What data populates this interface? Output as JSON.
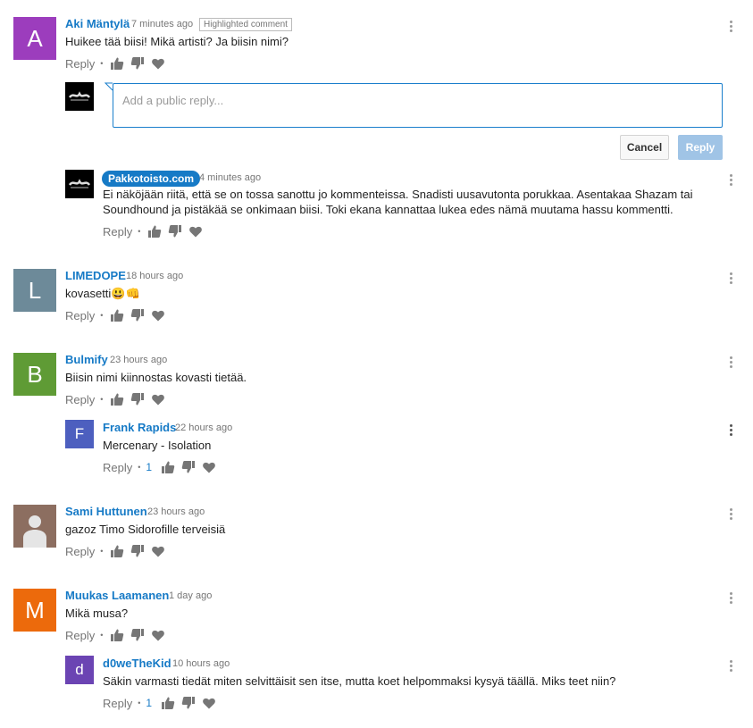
{
  "labels": {
    "reply": "Reply",
    "bullet": "•"
  },
  "reply_form": {
    "placeholder": "Add a public reply...",
    "cancel": "Cancel",
    "submit": "Reply"
  },
  "comments": [
    {
      "author": "Aki Mäntylä",
      "time": "7 minutes ago",
      "badge": "Highlighted comment",
      "text": "Huikee tää biisi! Mikä artisti? Ja biisin nimi?",
      "avatar_letter": "A",
      "avatar_color": "#9c3dbd"
    },
    {
      "author": "Pakkotoisto.com",
      "time": "4 minutes ago",
      "is_channel_owner": true,
      "text": "Ei näköjään riitä, että se on tossa sanottu jo kommenteissa. Snadisti uusavutonta porukkaa. Asentakaa Shazam tai Soundhound ja pistäkää se onkimaan biisi. Toki ekana kannattaa lukea edes nämä muutama hassu kommentti."
    },
    {
      "author": "LIMEDOPE",
      "time": "18 hours ago",
      "text": "kovasetti",
      "emoji": [
        "😃",
        "👊"
      ],
      "avatar_letter": "L",
      "avatar_color": "#6d8a99"
    },
    {
      "author": "Bulmify",
      "time": "23 hours ago",
      "text": "Biisin nimi kiinnostas kovasti tietää.",
      "avatar_letter": "B",
      "avatar_color": "#5f9b35"
    },
    {
      "author": "Frank Rapids",
      "time": "22 hours ago",
      "text": "Mercenary - Isolation",
      "likes": "1",
      "avatar_letter": "F",
      "avatar_color": "#4d5fbf"
    },
    {
      "author": "Sami Huttunen",
      "time": "23 hours ago",
      "text": "gazoz Timo Sidorofille terveisiä",
      "avatar_color": "#8c6e60"
    },
    {
      "author": "Muukas Laamanen",
      "time": "1 day ago",
      "text": "Mikä musa?",
      "avatar_letter": "M",
      "avatar_color": "#ec6a0c"
    },
    {
      "author": "d0weTheKid",
      "time": "10 hours ago",
      "text": "Säkin varmasti tiedät miten selvittäisit sen itse, mutta koet helpommaksi kysyä täällä. Miks teet niin?",
      "likes": "1",
      "avatar_letter": "d",
      "avatar_color": "#6b44b3"
    }
  ]
}
